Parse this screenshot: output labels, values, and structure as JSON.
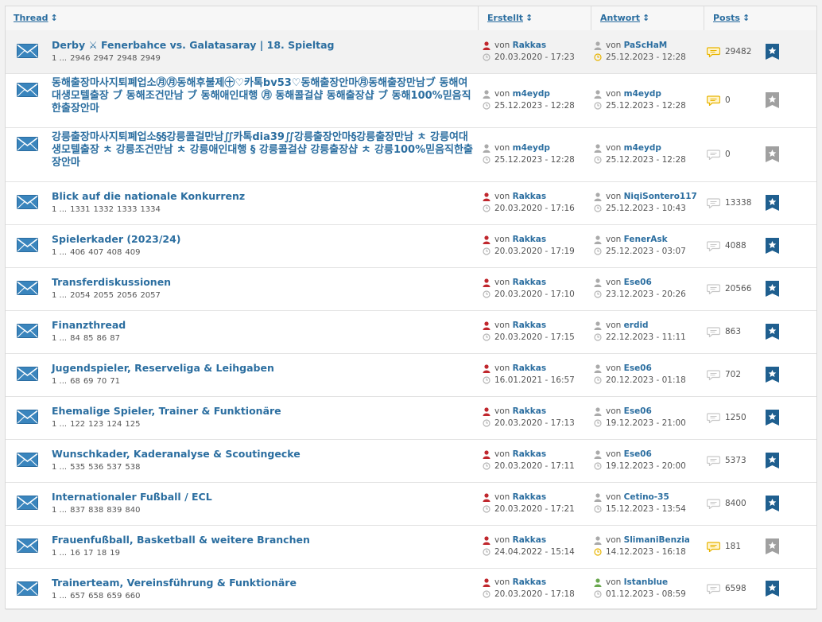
{
  "header": {
    "thread": "Thread",
    "created": "Erstellt",
    "reply": "Antwort",
    "posts": "Posts",
    "sort_glyph": "↕"
  },
  "von": "von",
  "threads": [
    {
      "title": "Derby ⚔ Fenerbahce vs. Galatasaray | 18. Spieltag",
      "pages": [
        "1 ...",
        "2946",
        "2947",
        "2948",
        "2949"
      ],
      "creator": "Rakkas",
      "created": "20.03.2020 - 17:23",
      "replier": "PaScHaM",
      "replied": "25.12.2023 - 12:28",
      "posts": "29482",
      "hot": true,
      "subscribed": true,
      "creator_color": "#c0272d",
      "replier_color": "#aaaaaa",
      "clock_hot": true
    },
    {
      "title": "동해출장마사지퇴폐업소㊊㊊동해후불제㊉♡카톡bv53♡동해출장안마㊊동해출장만남ブ 동해여대생모텔출장 ブ 동해조건만남 ブ 동해애인대행 ㊊ 동해콜걸샵 동해출장샵 ブ 동해100%믿음직한출장안마",
      "pages": [],
      "creator": "m4eydp",
      "created": "25.12.2023 - 12:28",
      "replier": "m4eydp",
      "replied": "25.12.2023 - 12:28",
      "posts": "0",
      "hot": true,
      "subscribed": false,
      "creator_color": "#aaaaaa",
      "replier_color": "#aaaaaa",
      "clock_hot": false
    },
    {
      "title": "강릉출장마사지퇴폐업소§§강릉콜걸만남∬카톡dia39∬강릉출장안마§강릉출장만남 ㅊ 강릉여대생모텔출장 ㅊ 강릉조건만남 ㅊ 강릉애인대행 § 강릉콜걸샵 강릉출장샵 ㅊ 강릉100%믿음직한출장안마",
      "pages": [],
      "creator": "m4eydp",
      "created": "25.12.2023 - 12:28",
      "replier": "m4eydp",
      "replied": "25.12.2023 - 12:28",
      "posts": "0",
      "hot": false,
      "subscribed": false,
      "creator_color": "#aaaaaa",
      "replier_color": "#aaaaaa",
      "clock_hot": false
    },
    {
      "title": "Blick auf die nationale Konkurrenz",
      "pages": [
        "1 ...",
        "1331",
        "1332",
        "1333",
        "1334"
      ],
      "creator": "Rakkas",
      "created": "20.03.2020 - 17:16",
      "replier": "NiqiSontero117",
      "replied": "25.12.2023 - 10:43",
      "posts": "13338",
      "hot": false,
      "subscribed": true,
      "creator_color": "#c0272d",
      "replier_color": "#aaaaaa",
      "clock_hot": false
    },
    {
      "title": "Spielerkader (2023/24)",
      "pages": [
        "1 ...",
        "406",
        "407",
        "408",
        "409"
      ],
      "creator": "Rakkas",
      "created": "20.03.2020 - 17:19",
      "replier": "FenerAsk",
      "replied": "25.12.2023 - 03:07",
      "posts": "4088",
      "hot": false,
      "subscribed": true,
      "creator_color": "#c0272d",
      "replier_color": "#aaaaaa",
      "clock_hot": false
    },
    {
      "title": "Transferdiskussionen",
      "pages": [
        "1 ...",
        "2054",
        "2055",
        "2056",
        "2057"
      ],
      "creator": "Rakkas",
      "created": "20.03.2020 - 17:10",
      "replier": "Ese06",
      "replied": "23.12.2023 - 20:26",
      "posts": "20566",
      "hot": false,
      "subscribed": true,
      "creator_color": "#c0272d",
      "replier_color": "#aaaaaa",
      "clock_hot": false
    },
    {
      "title": "Finanzthread",
      "pages": [
        "1 ...",
        "84",
        "85",
        "86",
        "87"
      ],
      "creator": "Rakkas",
      "created": "20.03.2020 - 17:15",
      "replier": "erdid",
      "replied": "22.12.2023 - 11:11",
      "posts": "863",
      "hot": false,
      "subscribed": true,
      "creator_color": "#c0272d",
      "replier_color": "#aaaaaa",
      "clock_hot": false
    },
    {
      "title": "Jugendspieler, Reserveliga & Leihgaben",
      "pages": [
        "1 ...",
        "68",
        "69",
        "70",
        "71"
      ],
      "creator": "Rakkas",
      "created": "16.01.2021 - 16:57",
      "replier": "Ese06",
      "replied": "20.12.2023 - 01:18",
      "posts": "702",
      "hot": false,
      "subscribed": true,
      "creator_color": "#c0272d",
      "replier_color": "#aaaaaa",
      "clock_hot": false
    },
    {
      "title": "Ehemalige Spieler, Trainer & Funktionäre",
      "pages": [
        "1 ...",
        "122",
        "123",
        "124",
        "125"
      ],
      "creator": "Rakkas",
      "created": "20.03.2020 - 17:13",
      "replier": "Ese06",
      "replied": "19.12.2023 - 21:00",
      "posts": "1250",
      "hot": false,
      "subscribed": true,
      "creator_color": "#c0272d",
      "replier_color": "#aaaaaa",
      "clock_hot": false
    },
    {
      "title": "Wunschkader, Kaderanalyse & Scoutingecke",
      "pages": [
        "1 ...",
        "535",
        "536",
        "537",
        "538"
      ],
      "creator": "Rakkas",
      "created": "20.03.2020 - 17:11",
      "replier": "Ese06",
      "replied": "19.12.2023 - 20:00",
      "posts": "5373",
      "hot": false,
      "subscribed": true,
      "creator_color": "#c0272d",
      "replier_color": "#aaaaaa",
      "clock_hot": false
    },
    {
      "title": "Internationaler Fußball / ECL",
      "pages": [
        "1 ...",
        "837",
        "838",
        "839",
        "840"
      ],
      "creator": "Rakkas",
      "created": "20.03.2020 - 17:21",
      "replier": "Cetino-35",
      "replied": "15.12.2023 - 13:54",
      "posts": "8400",
      "hot": false,
      "subscribed": true,
      "creator_color": "#c0272d",
      "replier_color": "#aaaaaa",
      "clock_hot": false
    },
    {
      "title": "Frauenfußball, Basketball & weitere Branchen",
      "pages": [
        "1 ...",
        "16",
        "17",
        "18",
        "19"
      ],
      "creator": "Rakkas",
      "created": "24.04.2022 - 15:14",
      "replier": "SlimaniBenzia",
      "replied": "14.12.2023 - 16:18",
      "posts": "181",
      "hot": true,
      "subscribed": false,
      "creator_color": "#c0272d",
      "replier_color": "#aaaaaa",
      "clock_hot": true
    },
    {
      "title": "Trainerteam, Vereinsführung & Funktionäre",
      "pages": [
        "1 ...",
        "657",
        "658",
        "659",
        "660"
      ],
      "creator": "Rakkas",
      "created": "20.03.2020 - 17:18",
      "replier": "Istanblue",
      "replied": "01.12.2023 - 08:59",
      "posts": "6598",
      "hot": false,
      "subscribed": true,
      "creator_color": "#c0272d",
      "replier_color": "#6aa84f",
      "clock_hot": false
    }
  ],
  "colors": {
    "link": "#2b6ea0",
    "hot": "#e8b400",
    "subscribed": "#1f5f8f",
    "unsubscribed": "#a0a0a0"
  }
}
